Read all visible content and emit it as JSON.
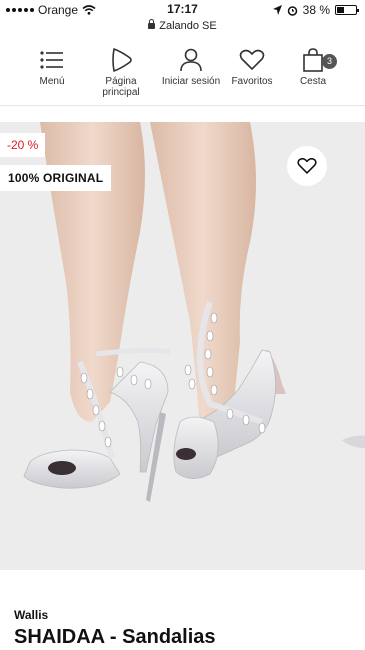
{
  "status": {
    "carrier": "Orange",
    "time": "17:17",
    "battery": "38 %",
    "battery_level": 0.38
  },
  "browser": {
    "url": "Zalando SE"
  },
  "nav": {
    "menu": "Menú",
    "home": "Página principal",
    "login": "Iniciar sesión",
    "favorites": "Favoritos",
    "cart": "Cesta",
    "cart_count": "3"
  },
  "product": {
    "discount_badge": "-20 %",
    "original_badge": "100% ORIGINAL",
    "brand": "Wallis",
    "name": "SHAIDAA - Sandalias"
  },
  "colors": {
    "discount": "#e01a22",
    "background": "#ececec"
  }
}
